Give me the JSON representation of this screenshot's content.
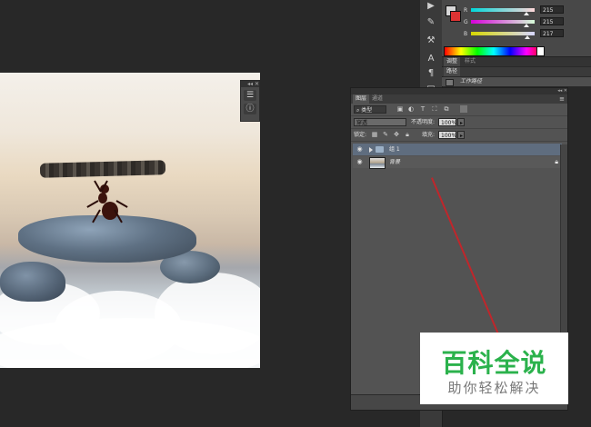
{
  "mini_panel": {
    "expand_label": "◂◂",
    "close_label": "✕"
  },
  "color_panel": {
    "fg_color": "#d7d7d8",
    "bg_color": "#dd3333",
    "sliders": [
      {
        "label": "R",
        "value": "215",
        "fraction": 0.84
      },
      {
        "label": "G",
        "value": "215",
        "fraction": 0.84
      },
      {
        "label": "B",
        "value": "217",
        "fraction": 0.85
      }
    ]
  },
  "adjust_tabs": {
    "tab1": "调整",
    "tab2": "样式"
  },
  "paths_tabs": {
    "tab1": "路径"
  },
  "work_path": {
    "label": "工作路径"
  },
  "layers_panel": {
    "header": "◂◂ ✕",
    "tabs": {
      "layers": "图层",
      "channels": "通道"
    },
    "filter": {
      "kind_label": "类型"
    },
    "blend": {
      "mode": "穿透",
      "opacity_label": "不透明度:",
      "opacity_value": "100%"
    },
    "lock": {
      "label": "锁定:",
      "fill_label": "填充:",
      "fill_value": "100%"
    },
    "layers": [
      {
        "name": "组 1",
        "type": "group",
        "selected": true
      },
      {
        "name": "背景",
        "type": "image",
        "selected": false,
        "locked": true
      }
    ]
  },
  "watermark": {
    "title": "百科全说",
    "subtitle": "助你轻松解决"
  },
  "colors": {
    "annotation": "#c0262b",
    "watermark_green": "#2bb24c",
    "selection": "#5f6d7f"
  }
}
